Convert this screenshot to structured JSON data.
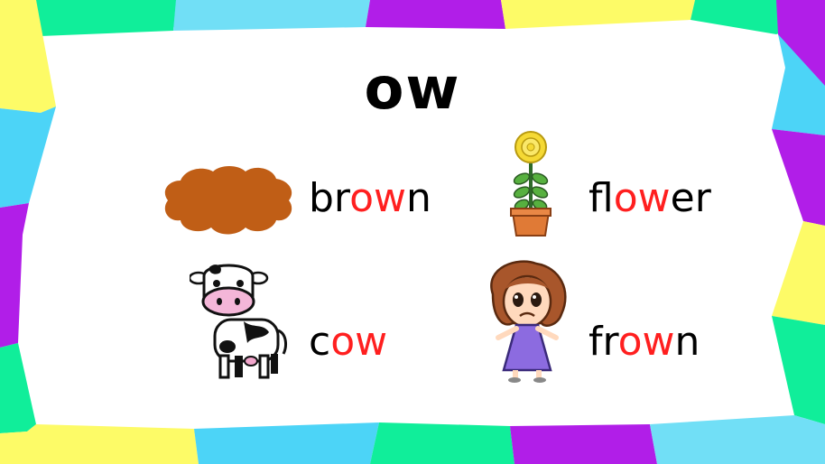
{
  "title": "ow",
  "words": {
    "brown": {
      "before": "br",
      "highlight": "ow",
      "after": "n"
    },
    "flower": {
      "before": "fl",
      "highlight": "ow",
      "after": "er"
    },
    "cow": {
      "before": "c",
      "highlight": "ow",
      "after": ""
    },
    "frown": {
      "before": "fr",
      "highlight": "ow",
      "after": "n"
    }
  },
  "colors": {
    "highlight": "#ff1f1f",
    "brown_blob": "#c05e16",
    "border": [
      "#fdfb67",
      "#4cd4f7",
      "#b11ee8",
      "#10ee9a",
      "#ffffff"
    ]
  },
  "icons": [
    "brown-blob-icon",
    "flower-pot-icon",
    "cow-icon",
    "frowning-girl-icon"
  ]
}
